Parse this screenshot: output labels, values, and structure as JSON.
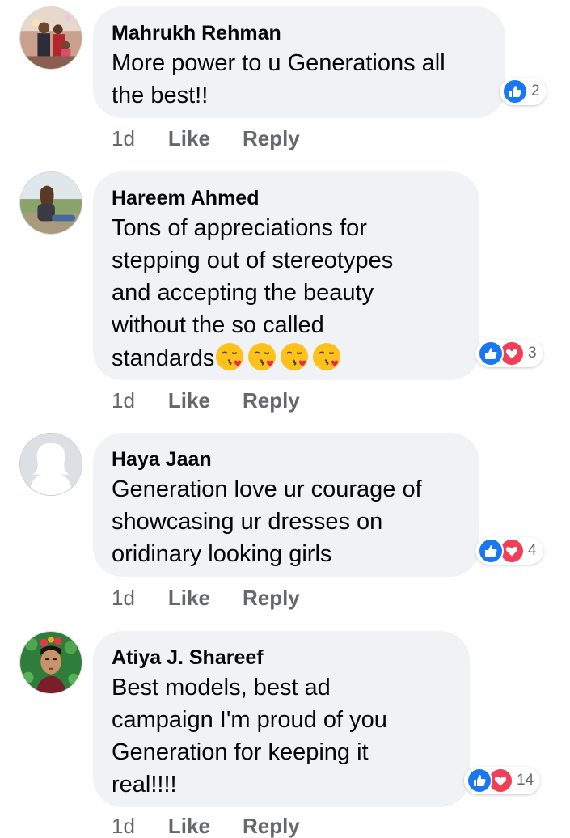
{
  "comments": [
    {
      "author": "Mahrukh Rehman",
      "text_lines": [
        "More power to u Generations all",
        "the best!!"
      ],
      "reaction_types": [
        "like"
      ],
      "reaction_count": "2",
      "time": "1d",
      "like_label": "Like",
      "reply_label": "Reply"
    },
    {
      "author": "Hareem Ahmed",
      "text_lines": [
        "Tons of appreciations for",
        "stepping out of stereotypes",
        "and accepting the beauty",
        "without the so called",
        "standards"
      ],
      "emoji": [
        "face-blowing-a-kiss",
        "face-blowing-a-kiss",
        "face-blowing-a-kiss",
        "face-blowing-a-kiss"
      ],
      "reaction_types": [
        "like",
        "love"
      ],
      "reaction_count": "3",
      "time": "1d",
      "like_label": "Like",
      "reply_label": "Reply"
    },
    {
      "author": "Haya Jaan",
      "text_lines": [
        "Generation love ur courage of",
        "showcasing ur dresses on",
        "oridinary looking girls"
      ],
      "reaction_types": [
        "like",
        "love"
      ],
      "reaction_count": "4",
      "time": "1d",
      "like_label": "Like",
      "reply_label": "Reply"
    },
    {
      "author": "Atiya J. Shareef",
      "text_lines": [
        "Best models, best ad",
        "campaign I'm proud of you",
        "Generation for keeping it",
        "real!!!!"
      ],
      "reaction_types": [
        "like",
        "love"
      ],
      "reaction_count": "14",
      "time": "1d",
      "like_label": "Like",
      "reply_label": "Reply"
    }
  ],
  "colors": {
    "bubble": "#f0f2f5",
    "meta_text": "#65676b",
    "like_blue": "#1877f2",
    "love_red": "#f33e58"
  },
  "icons": {
    "like": "thumbs-up-icon",
    "love": "heart-icon"
  }
}
